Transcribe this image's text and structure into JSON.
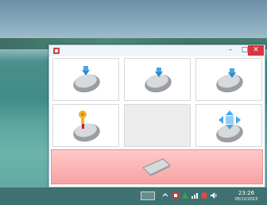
{
  "window": {
    "controls": {
      "minimize": "–",
      "maximize": "□",
      "close": "✕"
    },
    "accent_color": "#d9363e"
  },
  "grid": [
    {
      "icon": "mouse-left-click-icon"
    },
    {
      "icon": "mouse-middle-click-icon"
    },
    {
      "icon": "mouse-right-click-icon"
    },
    {
      "icon": "mouse-drag-icon"
    },
    {
      "icon": ""
    },
    {
      "icon": "mouse-scroll-icon"
    }
  ],
  "bottom_bar": {
    "icon": "keyboard-icon",
    "color": "#f7a2a2"
  },
  "taskbar": {
    "time": "23:26",
    "date": "05/12/2015",
    "tray_icons": [
      "keyboard-icon",
      "chevron-up-icon",
      "app-tray-icon",
      "network-icon",
      "signal-icon",
      "volume-icon",
      "power-icon"
    ]
  }
}
